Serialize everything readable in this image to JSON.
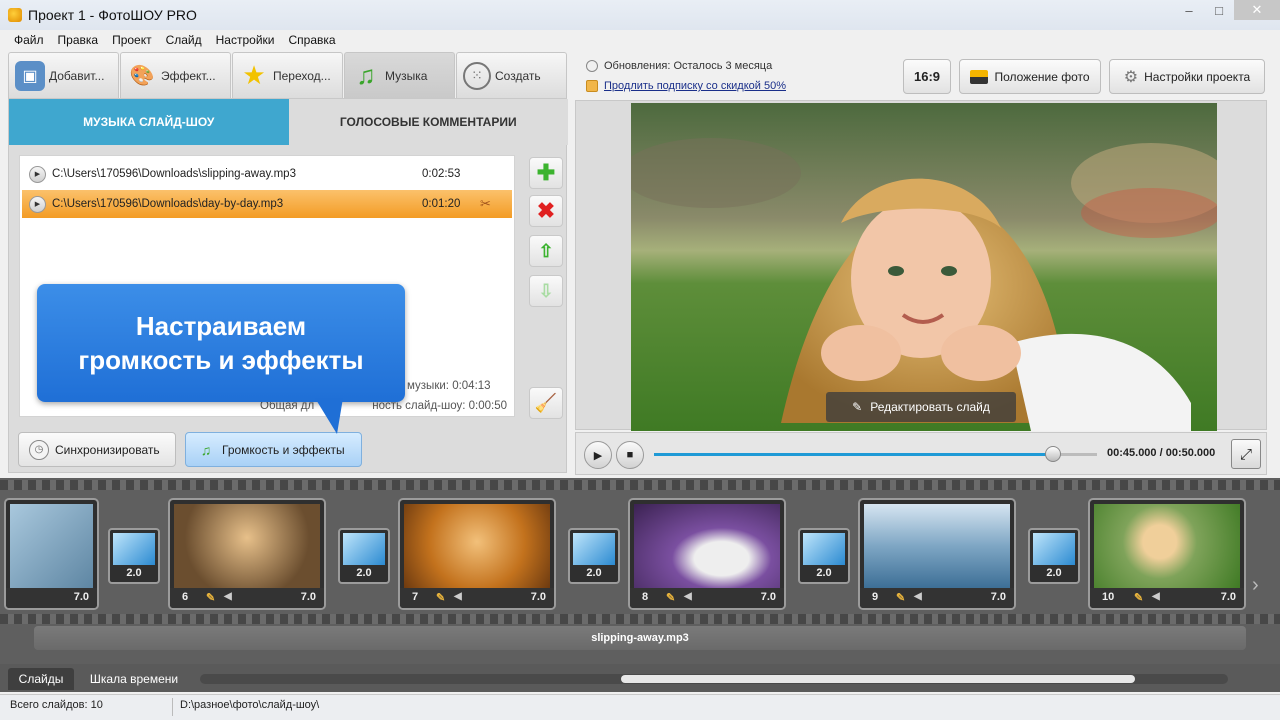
{
  "window": {
    "title": "Проект 1 - ФотоШОУ PRO"
  },
  "menu": [
    "Файл",
    "Правка",
    "Проект",
    "Слайд",
    "Настройки",
    "Справка"
  ],
  "tabs": [
    {
      "label": "Добавит...",
      "icon": "photo-add-icon",
      "active": false
    },
    {
      "label": "Эффект...",
      "icon": "palette-icon",
      "active": false
    },
    {
      "label": "Переход...",
      "icon": "star-icon",
      "active": false
    },
    {
      "label": "Музыка",
      "icon": "music-note-icon",
      "active": true
    },
    {
      "label": "Создать",
      "icon": "film-reel-icon",
      "active": false
    }
  ],
  "subtabs": {
    "music": "МУЗЫКА СЛАЙД-ШОУ",
    "voice": "ГОЛОСОВЫЕ КОММЕНТАРИИ"
  },
  "tracks": [
    {
      "path": "C:\\Users\\170596\\Downloads\\slipping-away.mp3",
      "duration": "0:02:53",
      "selected": false
    },
    {
      "path": "C:\\Users\\170596\\Downloads\\day-by-day.mp3",
      "duration": "0:01:20",
      "selected": true
    }
  ],
  "totals": {
    "music_label_partial": "музыки:",
    "music_value": "0:04:13",
    "show_label_partial_a": "Общая дл",
    "show_label_partial_b": "ность слайд-шоу:",
    "show_value": "0:00:50"
  },
  "callout": {
    "line1": "Настраиваем",
    "line2": "громкость и эффекты"
  },
  "bottom_buttons": {
    "sync": "Синхронизировать",
    "volume": "Громкость и эффекты"
  },
  "updates": {
    "text": "Обновления: Осталось 3 месяца",
    "link": "Продлить подписку со скидкой 50%"
  },
  "top_buttons": {
    "ratio": "16:9",
    "photo_position": "Положение фото",
    "project_settings": "Настройки проекта"
  },
  "preview": {
    "edit_slide": "Редактировать слайд"
  },
  "player": {
    "time": "00:45.000 / 00:50.000",
    "progress": 0.9
  },
  "timeline": {
    "slides": [
      {
        "num": "",
        "duration": "7.0"
      },
      {
        "num": "6",
        "duration": "7.0"
      },
      {
        "num": "7",
        "duration": "7.0"
      },
      {
        "num": "8",
        "duration": "7.0"
      },
      {
        "num": "9",
        "duration": "7.0"
      },
      {
        "num": "10",
        "duration": "7.0"
      }
    ],
    "transitions": [
      "2.0",
      "2.0",
      "2.0",
      "2.0",
      "2.0"
    ],
    "audio_track": "slipping-away.mp3",
    "view_tabs": {
      "slides": "Слайды",
      "timeline": "Шкала времени"
    },
    "scroll_position": 0.41,
    "scroll_visible": 0.5
  },
  "status": {
    "slide_count": "Всего слайдов: 10",
    "path": "D:\\разное\\фото\\слайд-шоу\\"
  },
  "colors": {
    "accent": "#3fa7cf",
    "callout": "#2b7fe0",
    "selected_row": "#f5a63a"
  }
}
